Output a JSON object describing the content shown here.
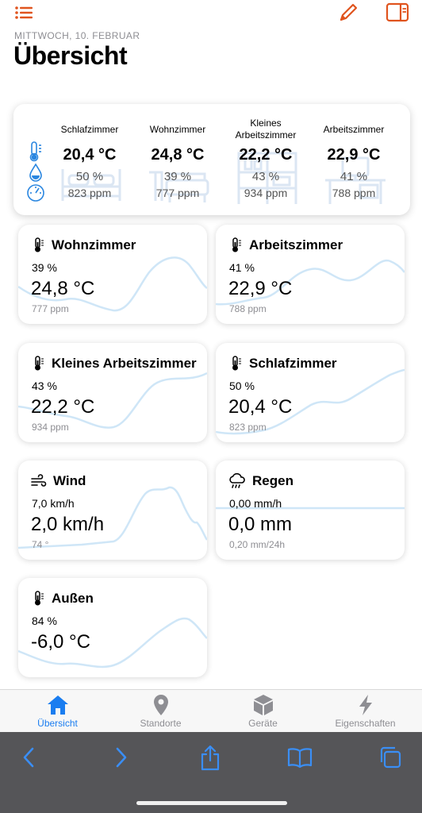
{
  "header": {
    "menu_icon": "list-icon",
    "edit_icon": "pencil-icon",
    "sidebar_icon": "sidebar-icon",
    "date": "MITTWOCH, 10. FEBRUAR",
    "title": "Übersicht"
  },
  "summary": {
    "icons": [
      "thermometer-icon",
      "drop-icon",
      "gauge-icon"
    ],
    "rooms": [
      {
        "name": "Schlafzimmer",
        "temp": "20,4 °C",
        "humidity": "50 %",
        "co2": "823 ppm",
        "icon": "bed-icon"
      },
      {
        "name": "Wohnzimmer",
        "temp": "24,8 °C",
        "humidity": "39 %",
        "co2": "777 ppm",
        "icon": "sofa-icon"
      },
      {
        "name": "Kleines Arbeitszimmer",
        "temp": "22,2 °C",
        "humidity": "43 %",
        "co2": "934 ppm",
        "icon": "shelf-icon"
      },
      {
        "name": "Arbeitszimmer",
        "temp": "22,9 °C",
        "humidity": "41 %",
        "co2": "788 ppm",
        "icon": "desk-icon"
      }
    ]
  },
  "cards": [
    {
      "title": "Wohnzimmer",
      "icon": "thermometer-icon",
      "sub": "39 %",
      "main": "24,8 °C",
      "foot": "777 ppm"
    },
    {
      "title": "Arbeitszimmer",
      "icon": "thermometer-icon",
      "sub": "41 %",
      "main": "22,9 °C",
      "foot": "788 ppm"
    },
    {
      "title": "Kleines Arbeitszimmer",
      "icon": "thermometer-icon",
      "sub": "43 %",
      "main": "22,2 °C",
      "foot": "934 ppm"
    },
    {
      "title": "Schlafzimmer",
      "icon": "thermometer-icon",
      "sub": "50 %",
      "main": "20,4 °C",
      "foot": "823 ppm"
    },
    {
      "title": "Wind",
      "icon": "wind-icon",
      "sub": "7,0 km/h",
      "main": "2,0 km/h",
      "foot": "74 °"
    },
    {
      "title": "Regen",
      "icon": "rain-cloud-icon",
      "sub": "0,00 mm/h",
      "main": "0,0 mm",
      "foot": "0,20 mm/24h"
    },
    {
      "title": "Außen",
      "icon": "thermometer-icon",
      "sub": "84 %",
      "main": "-6,0 °C",
      "foot": ""
    }
  ],
  "tabs": [
    {
      "label": "Übersicht",
      "icon": "house-icon",
      "active": true
    },
    {
      "label": "Standorte",
      "icon": "location-pin-icon",
      "active": false
    },
    {
      "label": "Geräte",
      "icon": "cube-icon",
      "active": false
    },
    {
      "label": "Eigenschaften",
      "icon": "bolt-icon",
      "active": false
    }
  ],
  "browser": {
    "icons": [
      "back-icon",
      "forward-icon",
      "share-icon",
      "bookmarks-icon",
      "tabs-icon"
    ]
  },
  "colors": {
    "accent": "#e0541e",
    "summary_icon": "#2a86e0",
    "tab_active": "#1a7df0",
    "tab_inactive": "#8e8e93",
    "browser_icon": "#3a8ef5",
    "sparkline": "#cfe6f7",
    "browser_bar": "#555558"
  }
}
